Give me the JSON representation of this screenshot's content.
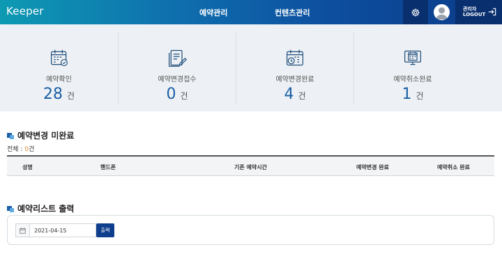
{
  "header": {
    "logo": "Keeper",
    "nav": [
      "예약관리",
      "컨텐츠관리"
    ],
    "user_name": "관리자",
    "logout_label": "LOGOUT",
    "gear_icon": "gear-icon",
    "logout_icon": "logout-icon",
    "colors": {
      "gradient_start": "#0e9ab3",
      "gradient_end": "#0b3b88",
      "dark_box": "#0a2f6f"
    }
  },
  "stats": [
    {
      "label": "예약확인",
      "value": "28",
      "unit": "건",
      "icon": "calendar-check-icon"
    },
    {
      "label": "예약변경접수",
      "value": "0",
      "unit": "건",
      "icon": "document-edit-icon"
    },
    {
      "label": "예약변경완료",
      "value": "4",
      "unit": "건",
      "icon": "calendar-clock-icon"
    },
    {
      "label": "예약취소완료",
      "value": "1",
      "unit": "건",
      "icon": "monitor-calendar-icon"
    }
  ],
  "section1": {
    "title": "예약변경 미완료",
    "total_label": "전체 : ",
    "total_count": "0",
    "total_unit": "건",
    "columns": [
      "성명",
      "핸드폰",
      "기존 예약시간",
      "예약변경 완료",
      "예약취소 완료"
    ]
  },
  "section2": {
    "title": "예약리스트 출력",
    "date_value": "2021-04-15",
    "print_label": "출력",
    "calendar_icon": "calendar-icon"
  },
  "accent_color": "#1a5fa5"
}
